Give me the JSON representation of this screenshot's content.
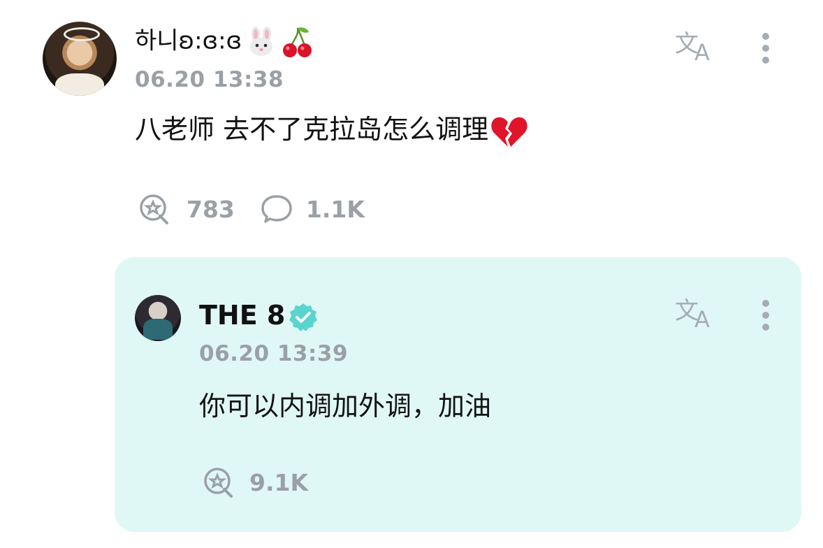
{
  "post": {
    "username": "하니ʚ:ɞ:ɞ",
    "timestamp": "06.20 13:38",
    "content": "八老师 去不了克拉岛怎么调理",
    "likes": "783",
    "comments": "1.1K",
    "emojis": [
      "rabbit-face",
      "cherries",
      "broken-heart"
    ]
  },
  "reply": {
    "username": "THE 8",
    "verified": true,
    "timestamp": "06.20 13:39",
    "content": "你可以内调加外调，加油",
    "likes": "9.1K"
  },
  "colors": {
    "reply_bg": "#e0f8f5",
    "verified": "#5ad4cf",
    "muted": "#9aa0a6"
  }
}
